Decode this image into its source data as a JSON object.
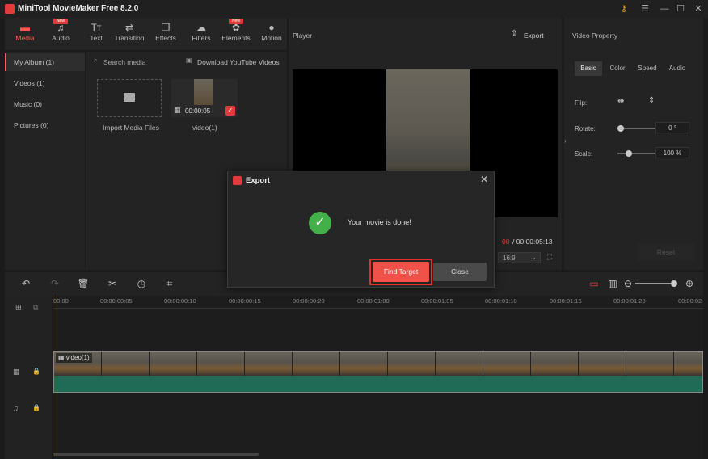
{
  "app": {
    "title": "MiniTool MovieMaker Free 8.2.0"
  },
  "toolbar": {
    "items": [
      {
        "label": "Media",
        "icon": "folder-icon",
        "active": true
      },
      {
        "label": "Audio",
        "icon": "music-icon",
        "badge": "New"
      },
      {
        "label": "Text",
        "icon": "text-icon"
      },
      {
        "label": "Transition",
        "icon": "transition-icon"
      },
      {
        "label": "Effects",
        "icon": "effects-icon"
      },
      {
        "label": "Filters",
        "icon": "filters-icon"
      },
      {
        "label": "Elements",
        "icon": "elements-icon",
        "badge": "New"
      },
      {
        "label": "Motion",
        "icon": "motion-icon"
      }
    ]
  },
  "nav": {
    "items": [
      {
        "label": "My Album  (1)"
      },
      {
        "label": "Videos  (1)"
      },
      {
        "label": "Music  (0)"
      },
      {
        "label": "Pictures  (0)"
      }
    ]
  },
  "media": {
    "search_label": "Search media",
    "download_label": "Download YouTube Videos",
    "import_label": "Import Media Files",
    "video_label": "video(1)",
    "video_duration": "00:00:05"
  },
  "player": {
    "title": "Player",
    "export_label": "Export",
    "time_current": "00",
    "time_total": "/ 00:00:05:13",
    "aspect": "16:9"
  },
  "props": {
    "title": "Video Property",
    "tabs": [
      "Basic",
      "Color",
      "Speed",
      "Audio"
    ],
    "flip_label": "Flip:",
    "rotate_label": "Rotate:",
    "rotate_value": "0 °",
    "scale_label": "Scale:",
    "scale_value": "100 %",
    "reset_label": "Reset"
  },
  "timeline": {
    "ticks": [
      "00:00",
      "00:00:00:05",
      "00:00:00:10",
      "00:00:00:15",
      "00:00:00:20",
      "00:00:01:00",
      "00:00:01:05",
      "00:00:01:10",
      "00:00:01:15",
      "00:00:01:20",
      "00:00:02"
    ],
    "clip_label": "video(1)"
  },
  "dialog": {
    "title": "Export",
    "message": "Your movie is done!",
    "find_target": "Find Target",
    "close": "Close"
  },
  "colors": {
    "accent": "#ff5a4f",
    "button": "#f0524a",
    "success": "#43b04a",
    "audio_wave": "#1f6b55"
  }
}
